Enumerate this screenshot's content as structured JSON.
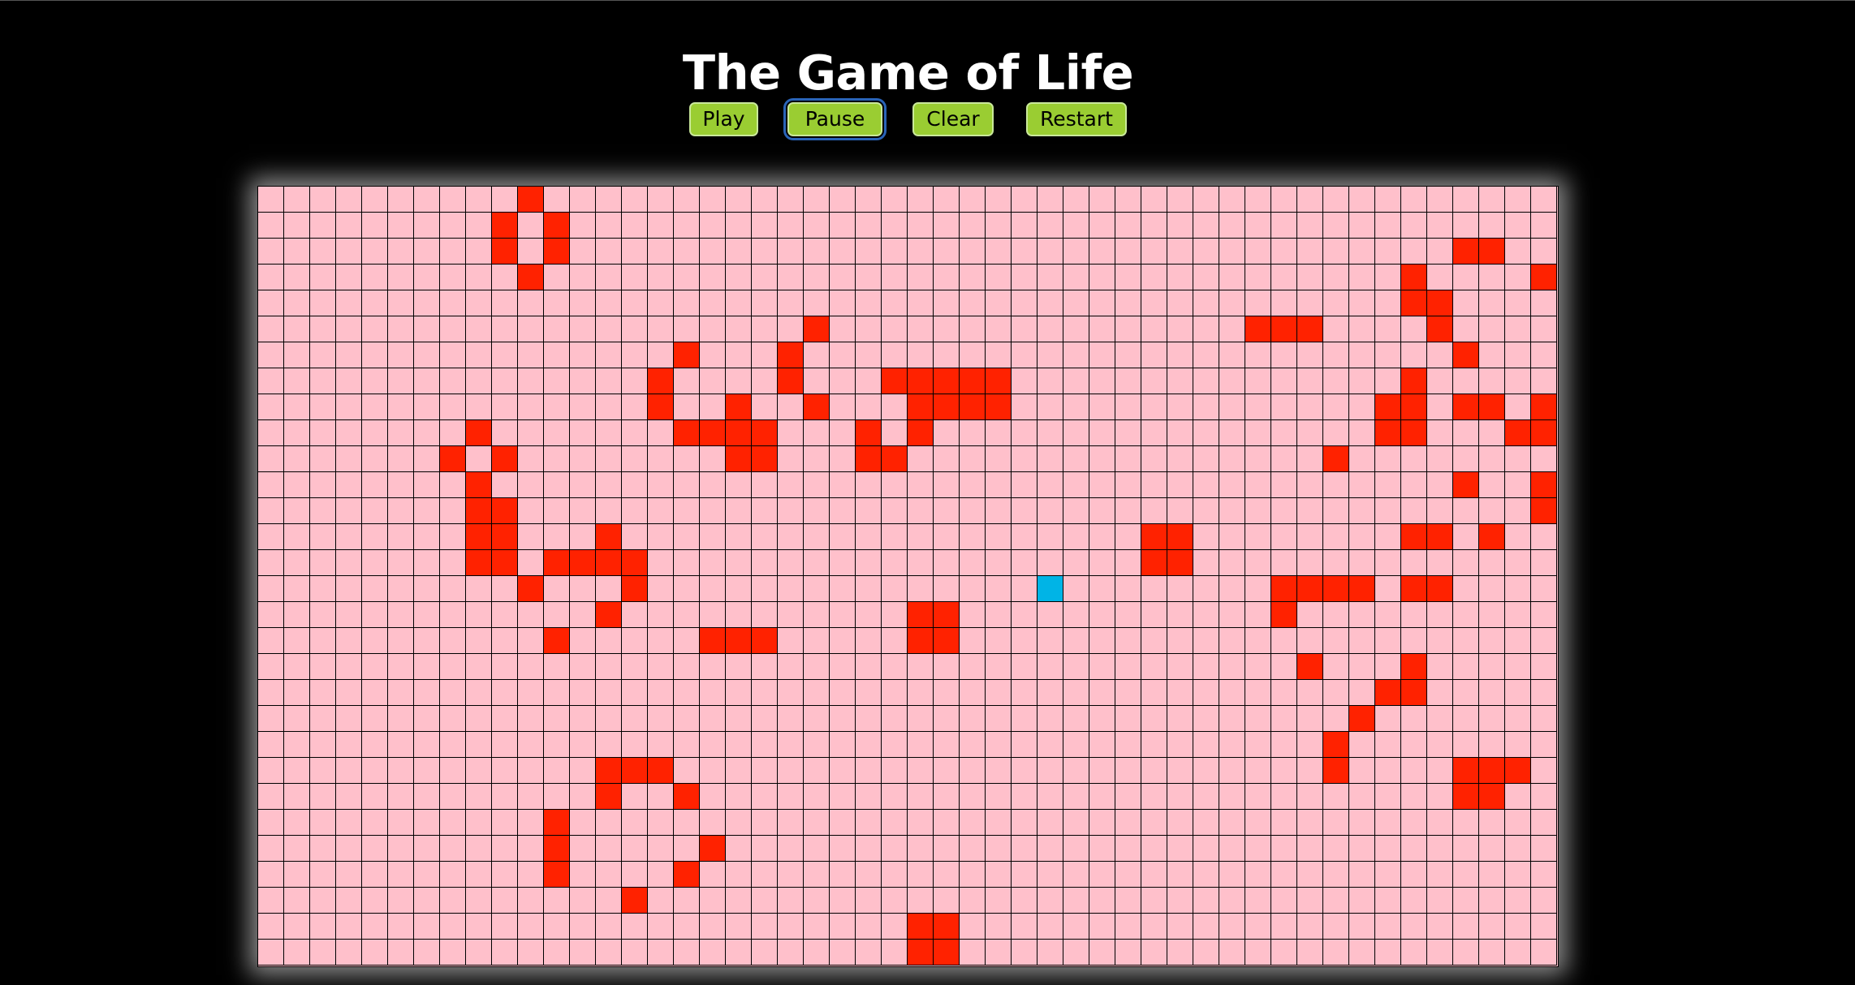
{
  "title": "The Game of Life",
  "buttons": {
    "play": "Play",
    "pause": "Pause",
    "clear": "Clear",
    "restart": "Restart"
  },
  "colors": {
    "background": "#000000",
    "dead_cell": "#ffc0cb",
    "alive_cell": "#ff2200",
    "highlight_cell": "#00b4e6",
    "button": "#9acd32"
  },
  "grid": {
    "columns": 50,
    "rows": 30,
    "highlight": [
      30,
      15
    ],
    "alive": [
      [
        10,
        0
      ],
      [
        9,
        1
      ],
      [
        11,
        1
      ],
      [
        9,
        2
      ],
      [
        11,
        2
      ],
      [
        10,
        3
      ],
      [
        46,
        2
      ],
      [
        47,
        2
      ],
      [
        44,
        3
      ],
      [
        49,
        3
      ],
      [
        44,
        4
      ],
      [
        45,
        4
      ],
      [
        45,
        5
      ],
      [
        46,
        6
      ],
      [
        21,
        5
      ],
      [
        38,
        5
      ],
      [
        39,
        5
      ],
      [
        40,
        5
      ],
      [
        16,
        6
      ],
      [
        20,
        6
      ],
      [
        15,
        7
      ],
      [
        20,
        7
      ],
      [
        24,
        7
      ],
      [
        25,
        7
      ],
      [
        26,
        7
      ],
      [
        27,
        7
      ],
      [
        28,
        7
      ],
      [
        44,
        7
      ],
      [
        15,
        8
      ],
      [
        18,
        8
      ],
      [
        21,
        8
      ],
      [
        25,
        8
      ],
      [
        26,
        8
      ],
      [
        27,
        8
      ],
      [
        28,
        8
      ],
      [
        43,
        8
      ],
      [
        44,
        8
      ],
      [
        46,
        8
      ],
      [
        47,
        8
      ],
      [
        49,
        8
      ],
      [
        8,
        9
      ],
      [
        16,
        9
      ],
      [
        17,
        9
      ],
      [
        18,
        9
      ],
      [
        19,
        9
      ],
      [
        23,
        9
      ],
      [
        25,
        9
      ],
      [
        43,
        9
      ],
      [
        44,
        9
      ],
      [
        48,
        9
      ],
      [
        49,
        9
      ],
      [
        7,
        10
      ],
      [
        9,
        10
      ],
      [
        18,
        10
      ],
      [
        19,
        10
      ],
      [
        23,
        10
      ],
      [
        24,
        10
      ],
      [
        41,
        10
      ],
      [
        8,
        11
      ],
      [
        46,
        11
      ],
      [
        49,
        11
      ],
      [
        8,
        12
      ],
      [
        9,
        12
      ],
      [
        49,
        12
      ],
      [
        8,
        13
      ],
      [
        9,
        13
      ],
      [
        13,
        13
      ],
      [
        34,
        13
      ],
      [
        35,
        13
      ],
      [
        44,
        13
      ],
      [
        45,
        13
      ],
      [
        47,
        13
      ],
      [
        8,
        14
      ],
      [
        9,
        14
      ],
      [
        11,
        14
      ],
      [
        12,
        14
      ],
      [
        13,
        14
      ],
      [
        14,
        14
      ],
      [
        34,
        14
      ],
      [
        35,
        14
      ],
      [
        10,
        15
      ],
      [
        14,
        15
      ],
      [
        39,
        15
      ],
      [
        40,
        15
      ],
      [
        41,
        15
      ],
      [
        42,
        15
      ],
      [
        44,
        15
      ],
      [
        45,
        15
      ],
      [
        13,
        16
      ],
      [
        25,
        16
      ],
      [
        26,
        16
      ],
      [
        39,
        16
      ],
      [
        11,
        17
      ],
      [
        17,
        17
      ],
      [
        18,
        17
      ],
      [
        19,
        17
      ],
      [
        25,
        17
      ],
      [
        26,
        17
      ],
      [
        40,
        18
      ],
      [
        44,
        18
      ],
      [
        43,
        19
      ],
      [
        44,
        19
      ],
      [
        42,
        20
      ],
      [
        41,
        21
      ],
      [
        41,
        22
      ],
      [
        13,
        22
      ],
      [
        14,
        22
      ],
      [
        15,
        22
      ],
      [
        46,
        22
      ],
      [
        47,
        22
      ],
      [
        48,
        22
      ],
      [
        13,
        23
      ],
      [
        16,
        23
      ],
      [
        46,
        23
      ],
      [
        47,
        23
      ],
      [
        11,
        24
      ],
      [
        11,
        25
      ],
      [
        17,
        25
      ],
      [
        11,
        26
      ],
      [
        16,
        26
      ],
      [
        14,
        27
      ],
      [
        25,
        28
      ],
      [
        26,
        28
      ],
      [
        25,
        29
      ],
      [
        26,
        29
      ]
    ]
  }
}
